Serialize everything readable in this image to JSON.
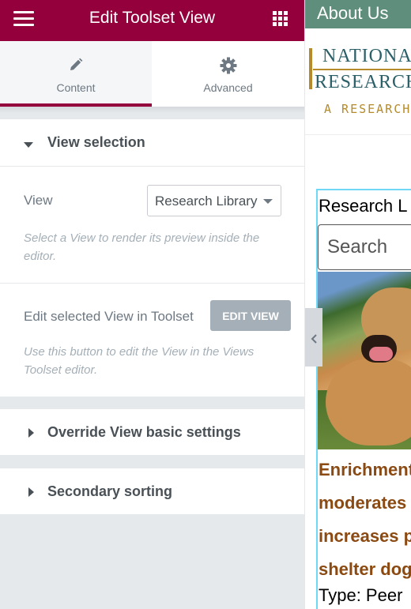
{
  "header": {
    "title": "Edit Toolset View"
  },
  "tabs": [
    {
      "label": "Content",
      "icon": "pencil-icon",
      "active": true
    },
    {
      "label": "Advanced",
      "icon": "gear-icon",
      "active": false
    }
  ],
  "view_selection": {
    "title": "View selection",
    "view_label": "View",
    "view_value": "Research Library",
    "view_description": "Select a View to render its preview inside the editor.",
    "edit_label": "Edit selected View in Toolset",
    "edit_button": "EDIT VIEW",
    "edit_description": "Use this button to edit the View in the Views Toolset editor."
  },
  "sections": {
    "override": "Override View basic settings",
    "sorting": "Secondary sorting"
  },
  "preview": {
    "about": "About Us",
    "logo_line1": "NATIONAL",
    "logo_line2": "RESEARCH",
    "logo_line3": "A RESEARCH & E",
    "heading": "Research L",
    "search_placeholder": "Search",
    "article_title_1": "Enrichment",
    "article_title_2": "moderates",
    "article_title_3": "increases p",
    "article_title_4": "shelter dog",
    "article_type": "Type: Peer"
  },
  "colors": {
    "brand": "#93003c",
    "about_bar": "#5f8f7c",
    "logo_teal": "#2b6069",
    "logo_gold": "#b58a2a",
    "article_link": "#8b4a12"
  }
}
